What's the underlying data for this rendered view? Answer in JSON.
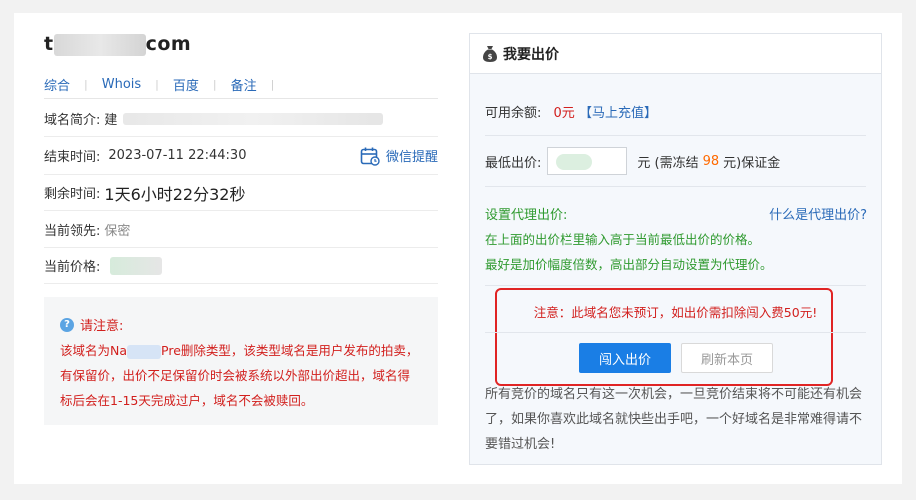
{
  "domain": {
    "prefix": "t",
    "suffix": "com"
  },
  "nav": [
    "综合",
    "Whois",
    "百度",
    "备注"
  ],
  "rows": {
    "intro_label": "域名简介:",
    "intro_value": "建",
    "end_label": "结束时间:",
    "end_value": "2023-07-11 22:44:30",
    "wechat_label": "微信提醒",
    "remain_label": "剩余时间:",
    "remain_value": "1天6小时22分32秒",
    "leader_label": "当前领先:",
    "leader_value": "保密",
    "price_label": "当前价格:"
  },
  "notice": {
    "title": "请注意:",
    "body_a": "该域名为Na",
    "body_b": "Pre删除类型，该类型域名是用户发布的拍卖，有保留价，出价不足保留价时会被系统以外部出价超出，域名得标后会在1-15天完成过户，域名不会被赎回。"
  },
  "panel": {
    "title": "我要出价",
    "balance_label": "可用余额:",
    "balance_value": "0元",
    "recharge": "【马上充值】",
    "min_bid_label": "最低出价:",
    "min_bid_unit": "元 (需冻结",
    "freeze_amount": "98",
    "deposit_suffix": "元)保证金",
    "proxy_label": "设置代理出价:",
    "proxy_help": "什么是代理出价?",
    "proxy_tip1": "在上面的出价栏里输入高于当前最低出价的价格。",
    "proxy_tip2": "最好是加价幅度倍数，高出部分自动设置为代理价。",
    "warning": "注意：此域名您未预订，如出价需扣除闯入费50元!",
    "bid_button": "闯入出价",
    "refresh_button": "刷新本页",
    "description": "所有竞价的域名只有这一次机会，一旦竞价结束将不可能还有机会了，如果你喜欢此域名就快些出手吧，一个好域名是非常难得请不要错过机会!"
  },
  "colors": {
    "accent": "#1a7ee5",
    "link": "#2a6ab8",
    "alert": "#d2201e",
    "proxy_green": "#2f9a2f",
    "freeze_orange": "#ff6a00"
  }
}
